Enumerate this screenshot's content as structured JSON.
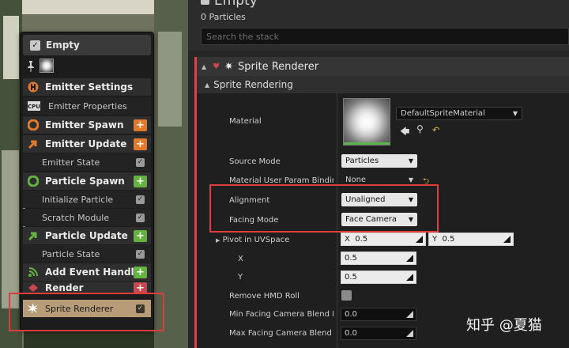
{
  "emitter": {
    "title": "Empty",
    "particle_count": "0 Particles",
    "search_placeholder": "Search the stack"
  },
  "stack": {
    "title": "Empty",
    "rows": [
      {
        "label": "Emitter Settings"
      },
      {
        "label": "Emitter Properties"
      },
      {
        "label": "Emitter Spawn"
      },
      {
        "label": "Emitter Update"
      },
      {
        "label": "Emitter State"
      },
      {
        "label": "Particle Spawn"
      },
      {
        "label": "Initialize Particle"
      },
      {
        "label": "Scratch Module"
      },
      {
        "label": "Particle Update"
      },
      {
        "label": "Particle State"
      },
      {
        "label": "Add Event Handler"
      },
      {
        "label": "Render"
      },
      {
        "label": "Sprite Renderer"
      }
    ],
    "cpu_label": "CPU"
  },
  "renderer": {
    "title": "Sprite Renderer",
    "section": "Sprite Rendering",
    "material_label": "Material",
    "material_value": "DefaultSpriteMaterial",
    "props": [
      {
        "label": "Source Mode",
        "value": "Particles"
      },
      {
        "label": "Material User Param Binding",
        "value": "None"
      },
      {
        "label": "Alignment",
        "value": "Unaligned"
      },
      {
        "label": "Facing Mode",
        "value": "Face Camera"
      }
    ],
    "pivot": {
      "label": "Pivot in UVSpace",
      "x_prefix": "X",
      "x": "0.5",
      "y_prefix": "Y",
      "y": "0.5"
    },
    "x_label": "X",
    "x_value": "0.5",
    "y_label": "Y",
    "y_value": "0.5",
    "remove_hmd": "Remove HMD Roll",
    "min_blend": {
      "label": "Min Facing Camera Blend Dis",
      "value": "0.0"
    },
    "max_blend": {
      "label": "Max Facing Camera Blend Dis",
      "value": "0.0"
    }
  },
  "colors": {
    "highlight_red": "#e03c3c",
    "orange": "#e3792b",
    "green": "#64b340",
    "sprite_row": "#b89c78"
  },
  "watermark": "知乎 @夏猫"
}
